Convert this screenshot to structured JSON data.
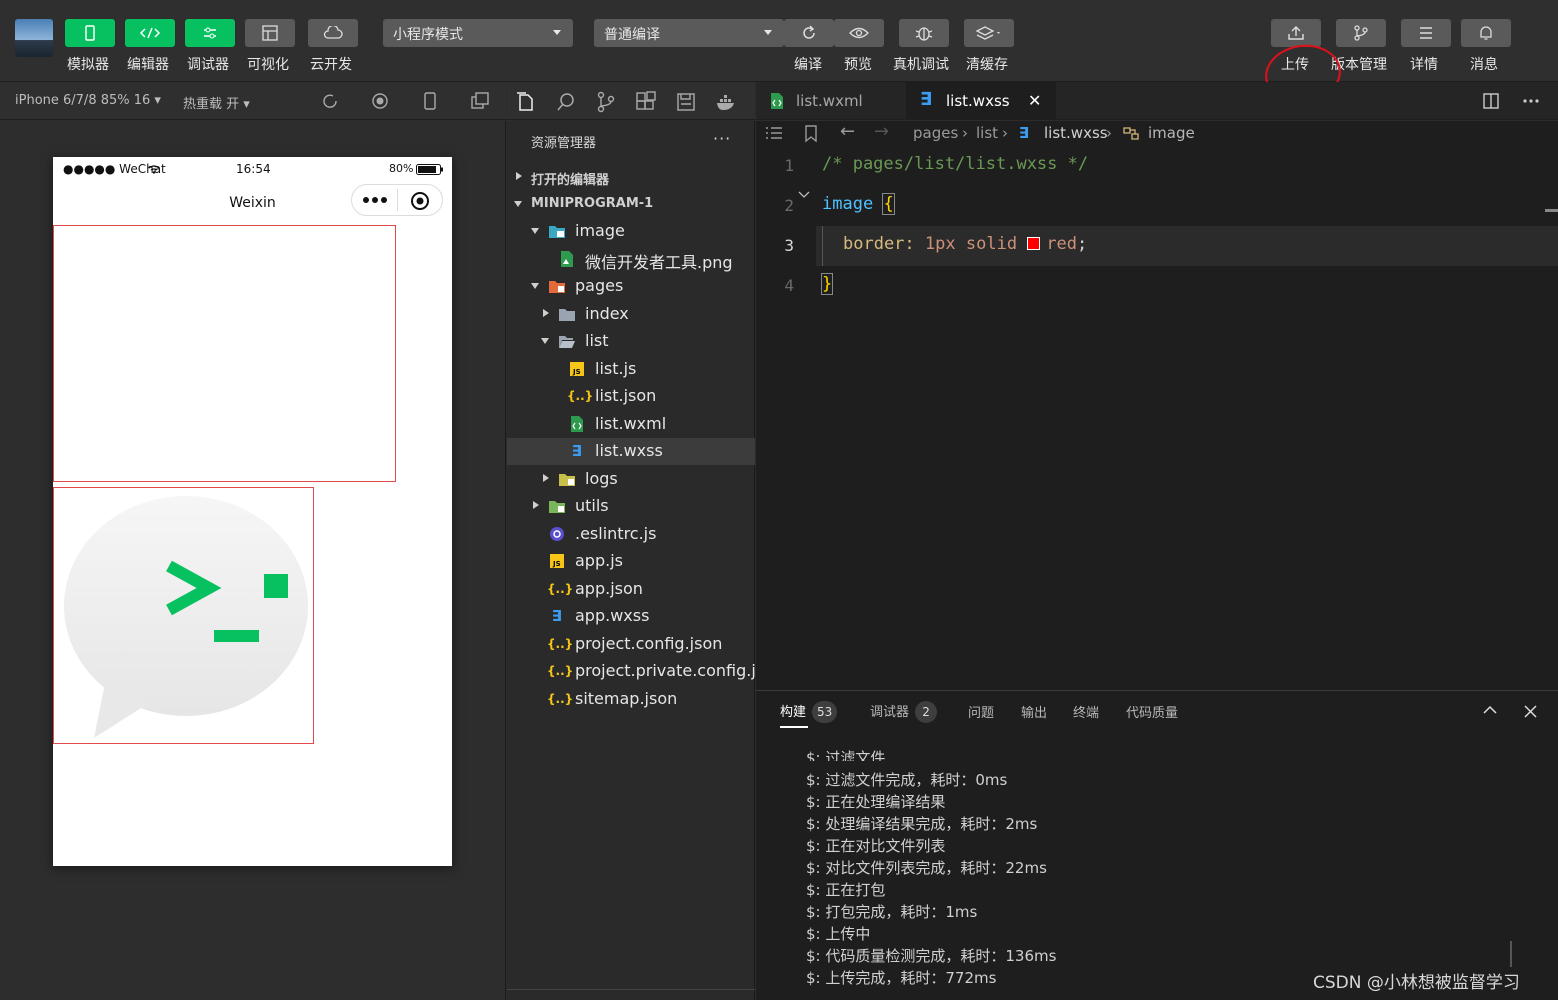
{
  "toolbar": {
    "left_buttons": [
      {
        "label": "模拟器",
        "icon": "phone-icon"
      },
      {
        "label": "编辑器",
        "icon": "code-icon"
      },
      {
        "label": "调试器",
        "icon": "debug-icon"
      },
      {
        "label": "可视化",
        "icon": "layout-icon"
      },
      {
        "label": "云开发",
        "icon": "cloud-icon"
      }
    ],
    "mode_select": "小程序模式",
    "compile_select": "普通编译",
    "mid_buttons": [
      {
        "label": "编译",
        "icon": "refresh-icon"
      },
      {
        "label": "预览",
        "icon": "eye-icon"
      },
      {
        "label": "真机调试",
        "icon": "bug-icon"
      },
      {
        "label": "清缓存",
        "icon": "layers-icon"
      }
    ],
    "right_buttons": [
      {
        "label": "上传",
        "icon": "upload-icon"
      },
      {
        "label": "版本管理",
        "icon": "branch-icon"
      },
      {
        "label": "详情",
        "icon": "menu-icon"
      },
      {
        "label": "消息",
        "icon": "bell-icon"
      }
    ]
  },
  "simulator": {
    "device": "iPhone 6/7/8 85% 16 ▾",
    "hot_reload": "热重载 开 ▾",
    "status_left": "●●●●● WeChat",
    "status_time": "16:54",
    "status_battery": "80%",
    "nav_title": "Weixin"
  },
  "explorer": {
    "header": "资源管理器",
    "more": "···",
    "open_editors": "打开的编辑器",
    "project": "MINIPROGRAM-1",
    "tree": [
      {
        "name": "image",
        "icon": "folder-image-icon"
      },
      {
        "name": "微信开发者工具.png",
        "icon": "image-file-icon"
      },
      {
        "name": "pages",
        "icon": "folder-pages-icon"
      },
      {
        "name": "index",
        "icon": "folder-icon"
      },
      {
        "name": "list",
        "icon": "folder-open-icon"
      },
      {
        "name": "list.js",
        "icon": "js-file-icon"
      },
      {
        "name": "list.json",
        "icon": "json-file-icon"
      },
      {
        "name": "list.wxml",
        "icon": "wxml-file-icon"
      },
      {
        "name": "list.wxss",
        "icon": "wxss-file-icon"
      },
      {
        "name": "logs",
        "icon": "folder-icon"
      },
      {
        "name": "utils",
        "icon": "folder-utils-icon"
      },
      {
        "name": ".eslintrc.js",
        "icon": "eslint-file-icon"
      },
      {
        "name": "app.js",
        "icon": "js-file-icon"
      },
      {
        "name": "app.json",
        "icon": "json-file-icon"
      },
      {
        "name": "app.wxss",
        "icon": "wxss-file-icon"
      },
      {
        "name": "project.config.json",
        "icon": "json-file-icon"
      },
      {
        "name": "project.private.config.js...",
        "icon": "json-file-icon"
      },
      {
        "name": "sitemap.json",
        "icon": "json-file-icon"
      }
    ]
  },
  "editor": {
    "tabs": [
      {
        "name": "list.wxml",
        "icon": "wxml-file-icon"
      },
      {
        "name": "list.wxss",
        "icon": "wxss-file-icon"
      }
    ],
    "close_glyph": "✕",
    "breadcrumb": [
      "pages",
      "list",
      "list.wxss",
      "image"
    ],
    "line_numbers": [
      "1",
      "2",
      "3",
      "4"
    ],
    "code": {
      "line1": "/* pages/list/list.wxss */",
      "line2_selector": "image",
      "line2_brace": "{",
      "line3_prop": "border:",
      "line3_value_a": "1px",
      "line3_value_b": "solid",
      "line3_color": "red",
      "line3_semi": ";",
      "line4_brace": "}"
    }
  },
  "panel": {
    "tabs": [
      {
        "label": "构建",
        "badge": "53"
      },
      {
        "label": "调试器",
        "badge": "2"
      },
      {
        "label": "问题",
        "badge": ""
      },
      {
        "label": "输出",
        "badge": ""
      },
      {
        "label": "终端",
        "badge": ""
      },
      {
        "label": "代码质量",
        "badge": ""
      }
    ],
    "logs": [
      "$: 过滤文件",
      "$: 过滤文件完成，耗时：0ms",
      "$: 正在处理编译结果",
      "$: 处理编译结果完成，耗时：2ms",
      "$: 正在对比文件列表",
      "$: 对比文件列表完成，耗时：22ms",
      "$: 正在打包",
      "$: 打包完成，耗时：1ms",
      "$: 上传中",
      "$: 代码质量检测完成，耗时：136ms",
      "$: 上传完成，耗时：772ms"
    ]
  },
  "watermark": "CSDN @小林想被监督学习",
  "colors": {
    "accent_green": "#07c160",
    "highlight_red": "#e0101a",
    "editor_bg": "#1e1e1e"
  }
}
